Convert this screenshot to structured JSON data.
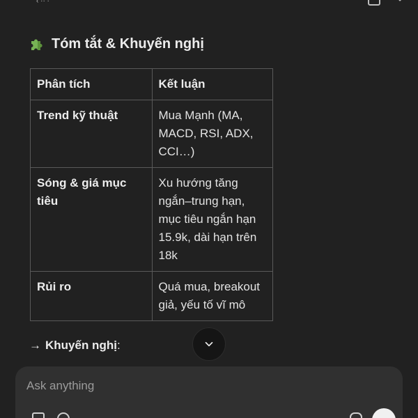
{
  "summary": {
    "heading": "Tóm tắt & Khuyến nghị",
    "table": {
      "headers": [
        "Phân tích",
        "Kết luận"
      ],
      "rows": [
        {
          "aspect": "Trend kỹ thuật",
          "conclusion": "Mua Mạnh (MA, MACD, RSI, ADX, CCI…)"
        },
        {
          "aspect": "Sóng & giá mục tiêu",
          "conclusion": "Xu hướng tăng ngắn–trung hạn, mục tiêu ngắn hạn 15.9k, dài hạn trên 18k"
        },
        {
          "aspect": "Rủi ro",
          "conclusion": "Quá mua, breakout giả, yếu tố vĩ mô"
        }
      ]
    },
    "recommendation": {
      "arrow": "→",
      "label": "Khuyến nghị",
      "suffix": ":"
    }
  },
  "composer": {
    "placeholder": "Ask anything"
  }
}
